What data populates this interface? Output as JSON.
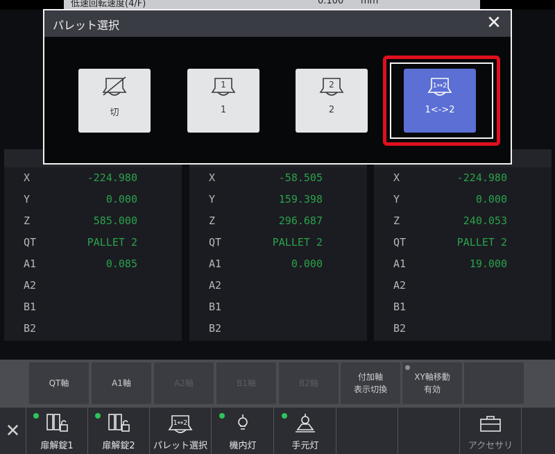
{
  "top_strip": {
    "left_text": "低速回転速度(4/F)",
    "value": "0.100",
    "unit": "mm"
  },
  "panels": [
    {
      "rows": [
        {
          "label": "X",
          "value": "-224.980"
        },
        {
          "label": "Y",
          "value": "0.000"
        },
        {
          "label": "Z",
          "value": "585.000"
        },
        {
          "label": "QT",
          "value": "PALLET 2"
        },
        {
          "label": "A1",
          "value": "0.085"
        },
        {
          "label": "A2",
          "value": ""
        },
        {
          "label": "B1",
          "value": ""
        },
        {
          "label": "B2",
          "value": ""
        }
      ]
    },
    {
      "rows": [
        {
          "label": "X",
          "value": "-58.505"
        },
        {
          "label": "Y",
          "value": "159.398"
        },
        {
          "label": "Z",
          "value": "296.687"
        },
        {
          "label": "QT",
          "value": "PALLET 2"
        },
        {
          "label": "A1",
          "value": "0.000"
        },
        {
          "label": "A2",
          "value": ""
        },
        {
          "label": "B1",
          "value": ""
        },
        {
          "label": "B2",
          "value": ""
        }
      ]
    },
    {
      "rows": [
        {
          "label": "X",
          "value": "-224.980"
        },
        {
          "label": "Y",
          "value": "0.000"
        },
        {
          "label": "Z",
          "value": "240.053"
        },
        {
          "label": "QT",
          "value": "PALLET 2"
        },
        {
          "label": "A1",
          "value": "19.000"
        },
        {
          "label": "A2",
          "value": ""
        },
        {
          "label": "B1",
          "value": ""
        },
        {
          "label": "B2",
          "value": ""
        }
      ]
    }
  ],
  "soft_buttons": [
    {
      "label": "QT軸",
      "enabled": true
    },
    {
      "label": "A1軸",
      "enabled": true
    },
    {
      "label": "A2軸",
      "enabled": false
    },
    {
      "label": "B1軸",
      "enabled": false
    },
    {
      "label": "B2軸",
      "enabled": false
    },
    {
      "label": "付加軸\n表示切換",
      "enabled": true
    },
    {
      "label": "XY軸移動\n有効",
      "enabled": true
    },
    {
      "label": "",
      "enabled": false
    }
  ],
  "bottom_bar": {
    "items": [
      {
        "label": "扉解錠1",
        "icon": "door-unlock-icon",
        "status": true
      },
      {
        "label": "扉解錠2",
        "icon": "door-unlock-icon",
        "status": true
      },
      {
        "label": "パレット選択",
        "icon": "pallet-swap-icon",
        "status": false
      },
      {
        "label": "機内灯",
        "icon": "interior-light-icon",
        "status": true
      },
      {
        "label": "手元灯",
        "icon": "work-light-icon",
        "status": true
      },
      {
        "label": "",
        "icon": "",
        "status": false
      },
      {
        "label": "",
        "icon": "",
        "status": false
      },
      {
        "label": "アクセサリ",
        "icon": "toolbox-icon",
        "status": false
      }
    ]
  },
  "dialog": {
    "title": "パレット選択",
    "options": [
      {
        "label": "切",
        "icon_text": "",
        "selected": false
      },
      {
        "label": "1",
        "icon_text": "1",
        "selected": false
      },
      {
        "label": "2",
        "icon_text": "2",
        "selected": false
      },
      {
        "label": "1<->2",
        "icon_text": "1↔2",
        "selected": true
      }
    ]
  },
  "colors": {
    "value_green": "#2aa24c",
    "selected_blue": "#5b6fd4",
    "highlight_red": "#e0101e",
    "status_dot": "#2fc45a"
  }
}
